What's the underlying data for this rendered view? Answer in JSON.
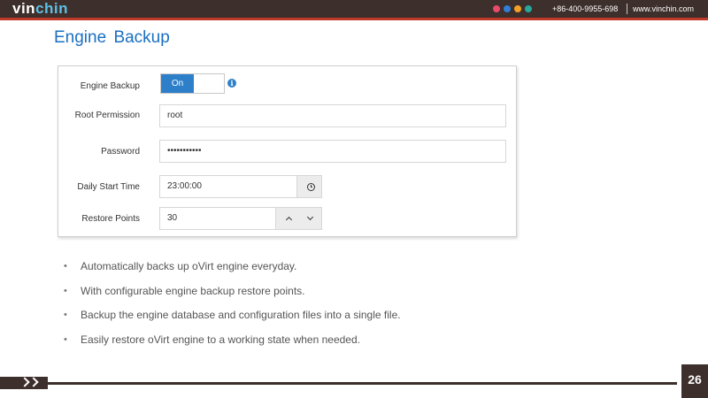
{
  "header": {
    "logo_part1": "vin",
    "logo_part2": "chin",
    "phone": "+86-400-9955-698",
    "website": "www.vinchin.com",
    "dot_colors": [
      "#e84a6b",
      "#2f7fd6",
      "#f2a128",
      "#25a99a"
    ]
  },
  "title": "Engine Backup",
  "form": {
    "engine_backup": {
      "label": "Engine Backup",
      "toggle_label": "On",
      "info_icon": "info-icon"
    },
    "root_permission": {
      "label": "Root Permission",
      "value": "root"
    },
    "password": {
      "label": "Password",
      "value": "•••••••••••"
    },
    "daily_start_time": {
      "label": "Daily Start Time",
      "value": "23:00:00",
      "icon": "clock-icon"
    },
    "restore_points": {
      "label": "Restore Points",
      "value": "30",
      "icons": [
        "chevron-up-icon",
        "chevron-down-icon"
      ]
    }
  },
  "bullets": [
    "Automatically backs up oVirt engine everyday.",
    "With configurable engine backup restore points.",
    "Backup the engine database and configuration files into a single file.",
    "Easily restore oVirt engine to a working state when needed."
  ],
  "page_number": "26",
  "colors": {
    "accent": "#2e7fc9",
    "title": "#1a6fc2",
    "bar": "#3d2f2b"
  }
}
